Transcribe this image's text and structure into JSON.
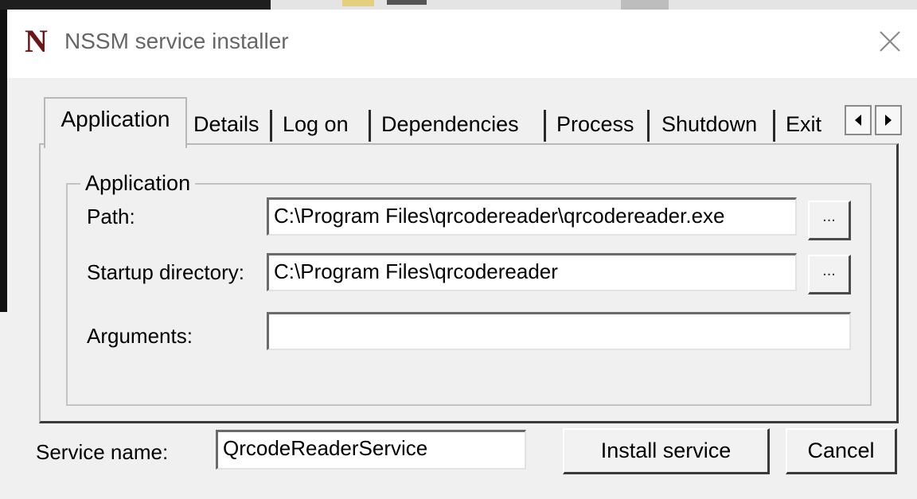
{
  "window": {
    "title": "NSSM service installer",
    "logo_letter": "N"
  },
  "tabs": [
    {
      "label": "Application",
      "active": true
    },
    {
      "label": "Details"
    },
    {
      "label": "Log on"
    },
    {
      "label": "Dependencies"
    },
    {
      "label": "Process"
    },
    {
      "label": "Shutdown"
    },
    {
      "label": "Exit"
    }
  ],
  "application_group": {
    "legend": "Application",
    "path": {
      "label": "Path:",
      "value": "C:\\Program Files\\qrcodereader\\qrcodereader.exe",
      "browse_label": "..."
    },
    "startup_directory": {
      "label": "Startup directory:",
      "value": "C:\\Program Files\\qrcodereader",
      "browse_label": "..."
    },
    "arguments": {
      "label": "Arguments:",
      "value": ""
    }
  },
  "service": {
    "label": "Service name:",
    "value": "QrcodeReaderService"
  },
  "buttons": {
    "install": "Install service",
    "cancel": "Cancel"
  },
  "icons": {
    "close": "close-icon",
    "scroll_left": "arrow-left-icon",
    "scroll_right": "arrow-right-icon"
  }
}
